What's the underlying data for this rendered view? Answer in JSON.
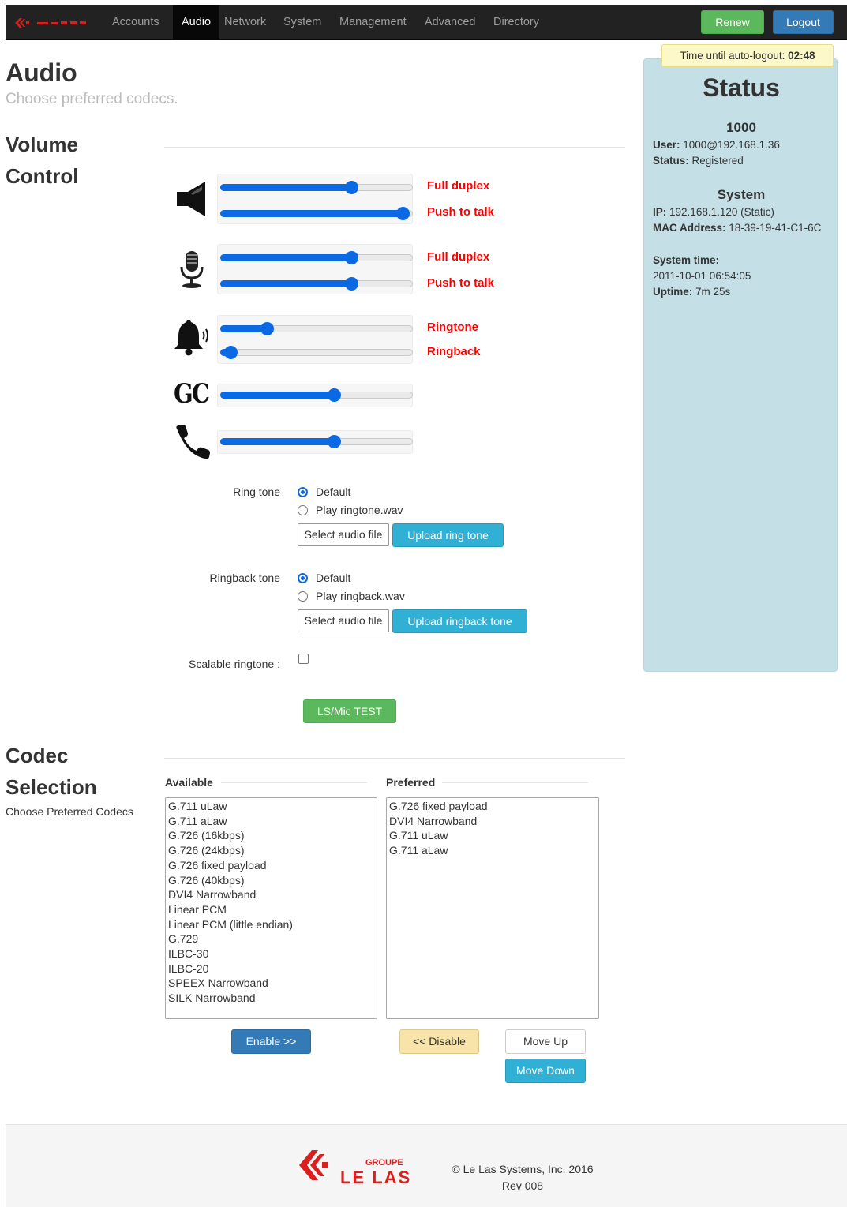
{
  "nav": {
    "brand": "LE LAS",
    "items": [
      "Accounts",
      "Audio",
      "Network",
      "System",
      "Management",
      "Advanced",
      "Directory"
    ],
    "active": "Audio",
    "renew_label": "Renew",
    "logout_label": "Logout"
  },
  "autologout": {
    "label": "Time until auto-logout:",
    "value": "02:48"
  },
  "status": {
    "title": "Status",
    "account_heading": "1000",
    "user_label": "User:",
    "user_value": "1000@192.168.1.36",
    "status_label": "Status:",
    "status_value": "Registered",
    "system_heading": "System",
    "ip_label": "IP:",
    "ip_value": "192.168.1.120 (Static)",
    "mac_label": "MAC Address:",
    "mac_value": "18-39-19-41-C1-6C",
    "time_label": "System time:",
    "time_value": "2011-10-01 06:54:05",
    "uptime_label": "Uptime:",
    "uptime_value": "7m 25s"
  },
  "page": {
    "title": "Audio",
    "subtitle": "Choose preferred codecs."
  },
  "volume": {
    "title": "Volume Control",
    "groups": [
      {
        "icon": "speaker-icon",
        "sliders": [
          {
            "label": "Full duplex",
            "level": 0.68
          },
          {
            "label": "Push to talk",
            "level": 0.95
          }
        ]
      },
      {
        "icon": "microphone-icon",
        "sliders": [
          {
            "label": "Full duplex",
            "level": 0.68
          },
          {
            "label": "Push to talk",
            "level": 0.68
          }
        ]
      },
      {
        "icon": "bell-icon",
        "sliders": [
          {
            "label": "Ringtone",
            "level": 0.24
          },
          {
            "label": "Ringback",
            "level": 0.05
          }
        ]
      },
      {
        "icon": "gc-icon",
        "icon_text": "GC",
        "sliders": [
          {
            "label": "",
            "level": 0.59
          }
        ]
      },
      {
        "icon": "phone-icon",
        "sliders": [
          {
            "label": "",
            "level": 0.59
          }
        ]
      }
    ]
  },
  "ring_tone": {
    "label": "Ring tone",
    "options": [
      "Default",
      "Play ringtone.wav"
    ],
    "selected": "Default",
    "select_label": "Select audio file",
    "upload_label": "Upload ring tone"
  },
  "ringback_tone": {
    "label": "Ringback tone",
    "options": [
      "Default",
      "Play ringback.wav"
    ],
    "selected": "Default",
    "select_label": "Select audio file",
    "upload_label": "Upload ringback tone"
  },
  "scalable_ringtone": {
    "label": "Scalable ringtone :",
    "checked": false
  },
  "test_button": "LS/Mic TEST",
  "codec": {
    "title": "Codec Selection",
    "subtitle": "Choose Preferred Codecs",
    "available_label": "Available",
    "preferred_label": "Preferred",
    "available": [
      "G.711 uLaw",
      "G.711 aLaw",
      "G.726 (16kbps)",
      "G.726 (24kbps)",
      "G.726 fixed payload",
      "G.726 (40kbps)",
      "DVI4 Narrowband",
      "Linear PCM",
      "Linear PCM (little endian)",
      "G.729",
      "ILBC-30",
      "ILBC-20",
      "SPEEX Narrowband",
      "SILK Narrowband"
    ],
    "preferred": [
      "G.726 fixed payload",
      "DVI4 Narrowband",
      "G.711 uLaw",
      "G.711 aLaw"
    ],
    "enable_label": "Enable >>",
    "disable_label": "<< Disable",
    "move_up_label": "Move Up",
    "move_down_label": "Move Down"
  },
  "footer": {
    "logo_top": "GROUPE",
    "logo_main": "LE LAS",
    "copyright": "© Le Las Systems, Inc. 2016",
    "rev": "Rev 008"
  },
  "colors": {
    "slider": "#0b69e4",
    "label_red": "#ff0000",
    "status_bg": "#c4dfe6"
  }
}
